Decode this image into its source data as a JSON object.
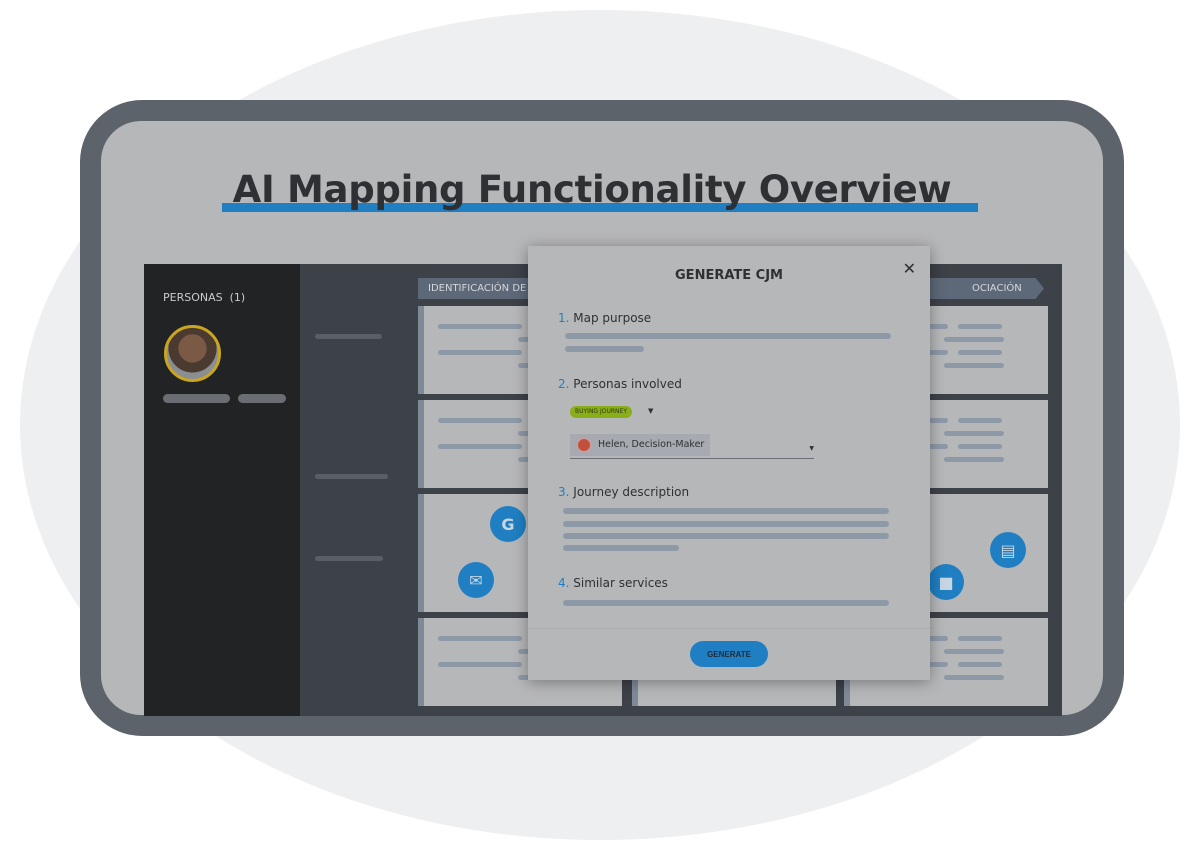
{
  "title": "AI Mapping Functionality Overview",
  "sidebar": {
    "personas_label": "PERSONAS",
    "personas_count": "(1)"
  },
  "stages": [
    "IDENTIFICACIÓN DE",
    "OCIACIÓN"
  ],
  "modal": {
    "title": "GENERATE CJM",
    "close_icon": "close-icon",
    "questions": [
      {
        "num": "1.",
        "label": "Map purpose"
      },
      {
        "num": "2.",
        "label": "Personas involved"
      },
      {
        "num": "3.",
        "label": "Journey description"
      },
      {
        "num": "4.",
        "label": "Similar services"
      }
    ],
    "journey_tag": "BUYING JOURNEY",
    "persona_selected": "Helen, Decision-Maker",
    "generate_label": "GENERATE"
  },
  "colors": {
    "accent": "#1f7fc2",
    "tag": "#8aae1a",
    "frame": "#5d636b"
  }
}
